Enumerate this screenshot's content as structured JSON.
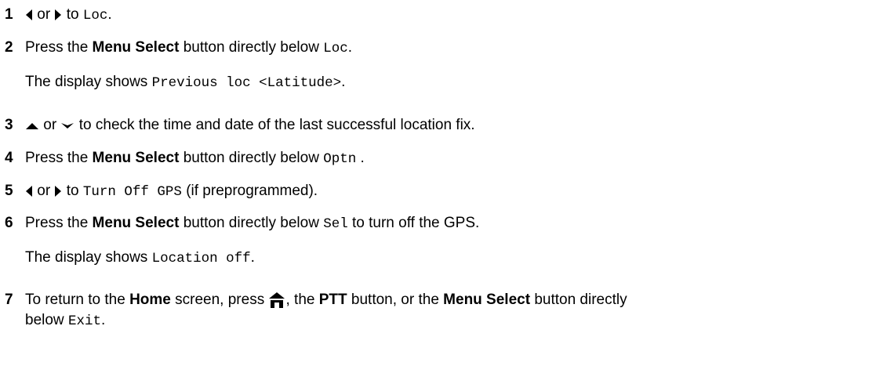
{
  "steps": [
    {
      "num": "1",
      "t1": "or",
      "t2": "to",
      "m1": "Loc",
      "t3": "."
    },
    {
      "num": "2",
      "t1": "Press the",
      "b1": "Menu Select",
      "t2": "button directly below",
      "m1": "Loc",
      "t3": ".",
      "sub_t1": "The display shows",
      "sub_m1": "Previous loc <Latitude>",
      "sub_t2": "."
    },
    {
      "num": "3",
      "t1": "or",
      "t2": "to check the time and date of the last successful location fix."
    },
    {
      "num": "4",
      "t1": "Press the",
      "b1": "Menu Select",
      "t2": "button directly below",
      "m1": "Optn",
      "t3": "."
    },
    {
      "num": "5",
      "t1": "or",
      "t2": "to",
      "m1": "Turn Off GPS",
      "t3": "(if preprogrammed)."
    },
    {
      "num": "6",
      "t1": "Press the",
      "b1": "Menu Select",
      "t2": "button directly below",
      "m1": "Sel",
      "t3": "to turn off the GPS.",
      "sub_t1": "The display shows",
      "sub_m1": "Location off",
      "sub_t2": "."
    },
    {
      "num": "7",
      "t1": "To return to the",
      "b1": "Home",
      "t2": "screen, press",
      "t3": ", the",
      "b2": "PTT",
      "t4": "button, or the",
      "b3": "Menu Select",
      "t5": "button directly",
      "line2_t1": "below",
      "line2_m1": "Exit",
      "line2_t2": "."
    }
  ],
  "icons": {
    "left": "left-arrow-icon",
    "right": "right-arrow-icon",
    "up": "up-arrow-icon",
    "down": "down-arrow-icon",
    "home": "home-icon"
  }
}
